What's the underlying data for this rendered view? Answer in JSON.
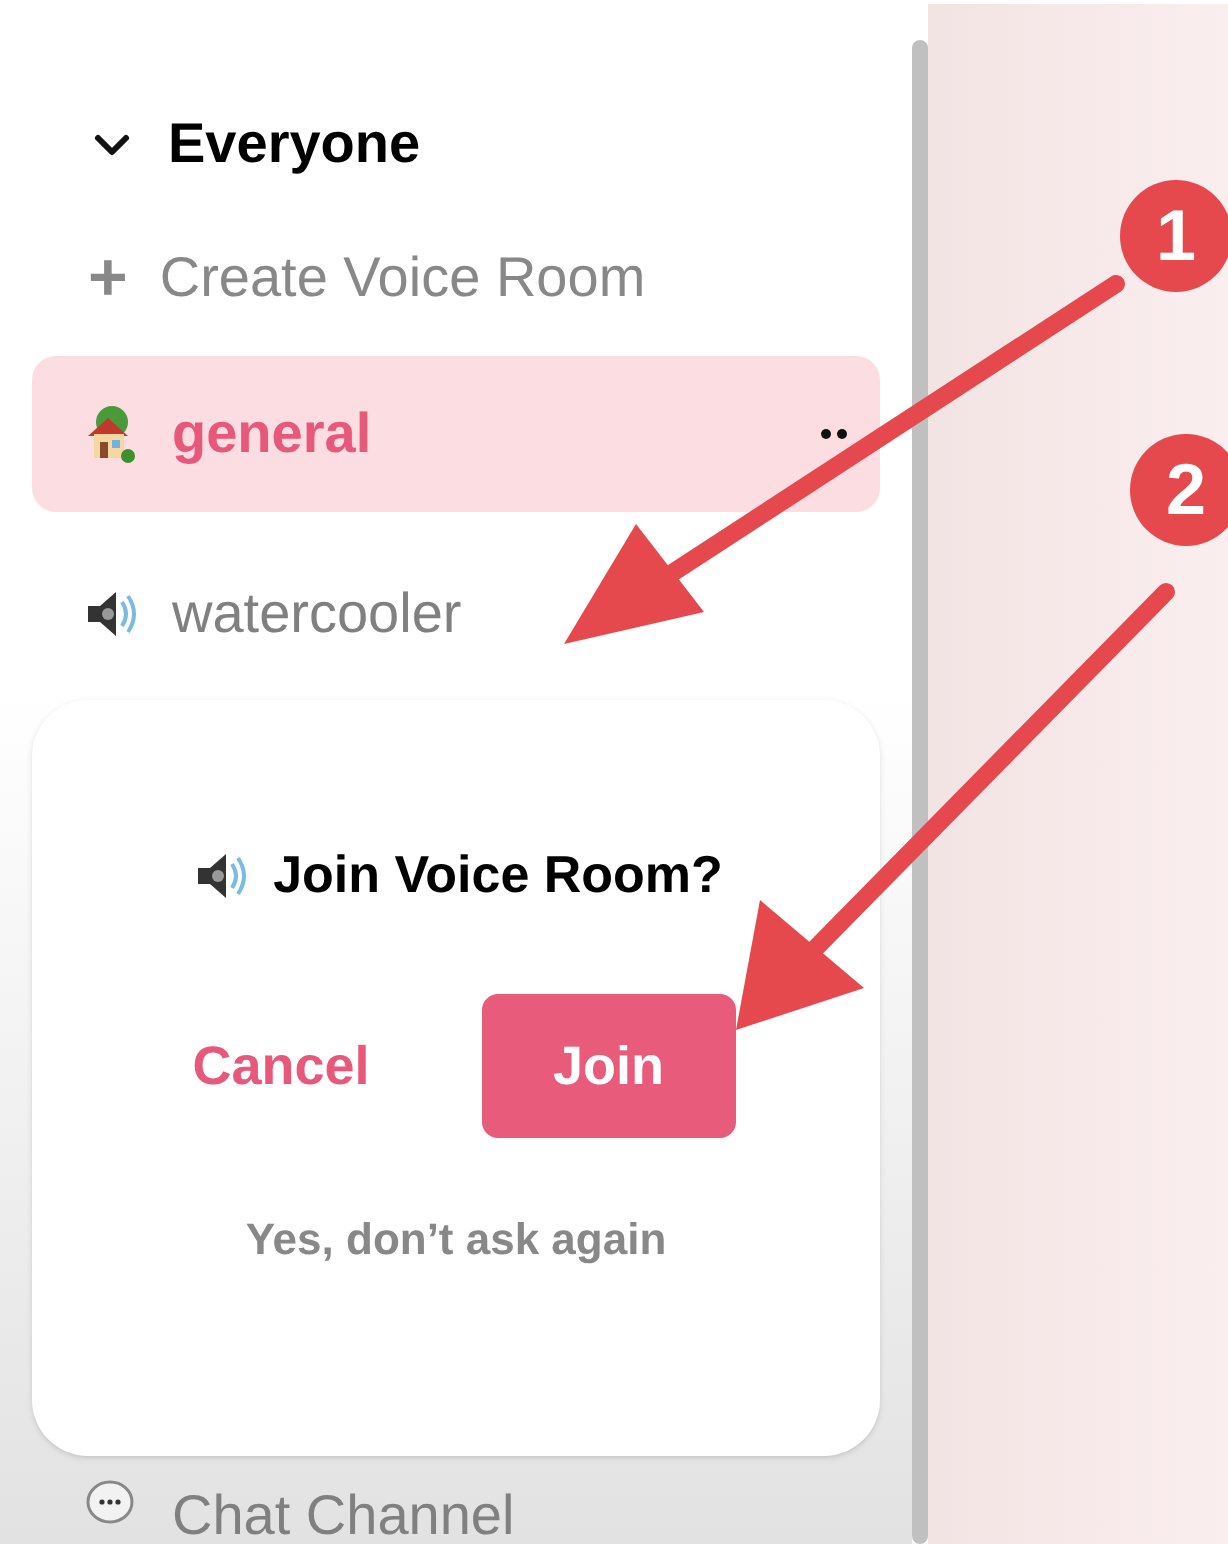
{
  "section": {
    "title": "Everyone",
    "expanded": true
  },
  "create_button": {
    "icon": "+",
    "label": "Create Voice Room"
  },
  "channels": [
    {
      "kind": "home",
      "name": "general",
      "selected": true
    },
    {
      "kind": "voice",
      "name": "watercooler",
      "selected": false
    }
  ],
  "popover": {
    "title": "Join Voice Room?",
    "cancel": "Cancel",
    "join": "Join",
    "dont_ask": "Yes, don’t ask again"
  },
  "below_channel": {
    "kind": "chat",
    "name": "Chat Channel"
  },
  "annotations": [
    {
      "number": "1"
    },
    {
      "number": "2"
    }
  ]
}
